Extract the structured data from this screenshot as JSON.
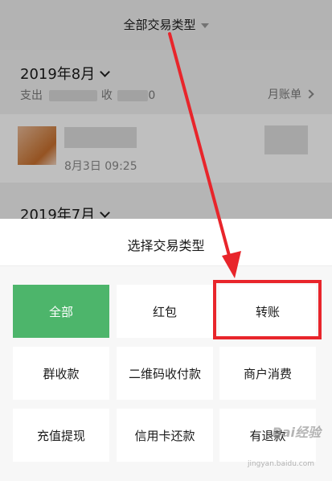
{
  "header": {
    "filter_label": "全部交易类型"
  },
  "months": [
    {
      "label": "2019年8月"
    },
    {
      "label": "2019年7月"
    }
  ],
  "summary": {
    "expense_prefix": "支出",
    "income_fragment": "收",
    "amount_fragment": "0",
    "monthly_bill_label": "月账单"
  },
  "bill": {
    "time": "8月3日 09:25"
  },
  "sheet": {
    "title": "选择交易类型",
    "options": [
      {
        "label": "全部",
        "selected": true
      },
      {
        "label": "红包",
        "selected": false
      },
      {
        "label": "转账",
        "selected": false,
        "highlighted": true
      },
      {
        "label": "群收款",
        "selected": false
      },
      {
        "label": "二维码收付款",
        "selected": false
      },
      {
        "label": "商户消费",
        "selected": false
      },
      {
        "label": "充值提现",
        "selected": false
      },
      {
        "label": "信用卡还款",
        "selected": false
      },
      {
        "label": "有退款",
        "selected": false
      }
    ]
  },
  "watermark": {
    "brand": "Bai经验",
    "url": "jingyan.baidu.com"
  },
  "colors": {
    "selected_bg": "#4db56b",
    "highlight_border": "#e8252b",
    "arrow": "#e8252b"
  }
}
